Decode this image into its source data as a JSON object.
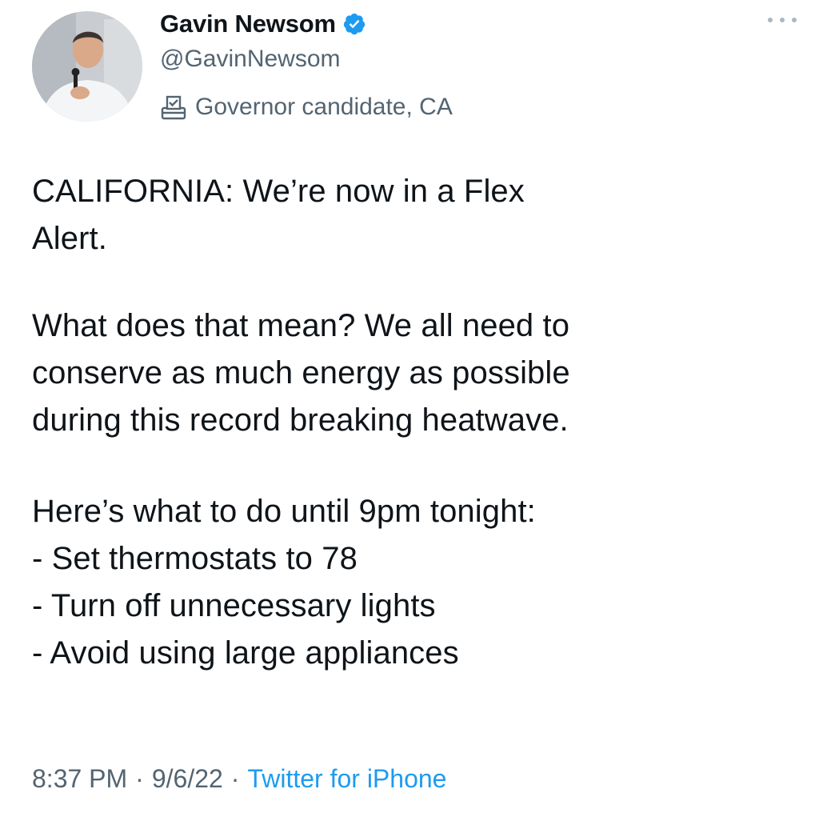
{
  "author": {
    "display_name": "Gavin Newsom",
    "handle": "@GavinNewsom",
    "label": "Governor candidate, CA",
    "avatar": "profile-photo",
    "verified_icon": "verified-badge-icon",
    "label_icon": "ballot-box-icon",
    "verified_color": "#1d9bf0"
  },
  "tweet": {
    "lines": [
      "CALIFORNIA: We’re now in a Flex",
      "Alert.",
      "What does that mean? We all need to",
      "conserve as much energy as possible",
      "during this record breaking heatwave.",
      "Here’s what to do until 9pm tonight:",
      "- Set thermostats to 78",
      "- Turn off unnecessary lights",
      "- Avoid using large appliances"
    ]
  },
  "meta": {
    "time": "8:37 PM",
    "separator": "·",
    "date": "9/6/22",
    "source": "Twitter for iPhone",
    "source_color": "#1d9bf0"
  },
  "menu": {
    "icon": "more-options-icon"
  }
}
